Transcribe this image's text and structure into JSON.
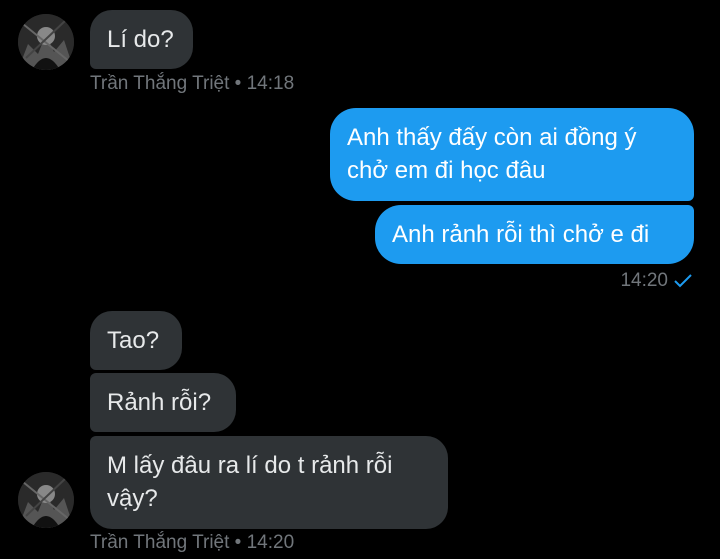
{
  "messages": [
    {
      "text": "Lí do?"
    },
    {
      "text": "Anh thấy đấy còn ai đồng ý\nchở em đi học đâu"
    },
    {
      "text": "Anh rảnh rỗi thì chở e đi"
    },
    {
      "text": "Tao?"
    },
    {
      "text": "Rảnh rỗi?"
    },
    {
      "text": "M lấy đâu ra lí do t rảnh rỗi\nvậy?"
    }
  ],
  "meta": {
    "first": "Trần Thắng Triệt • 14:18",
    "sent_time": "14:20",
    "last": "Trần Thắng Triệt • 14:20"
  },
  "colors": {
    "incoming_bubble": "#2f3336",
    "outgoing_bubble": "#1d9bf0",
    "meta_text": "#71767b",
    "background": "#000000"
  },
  "icons": {
    "avatar": "user-avatar-icon",
    "read_receipt": "checkmark-icon"
  }
}
